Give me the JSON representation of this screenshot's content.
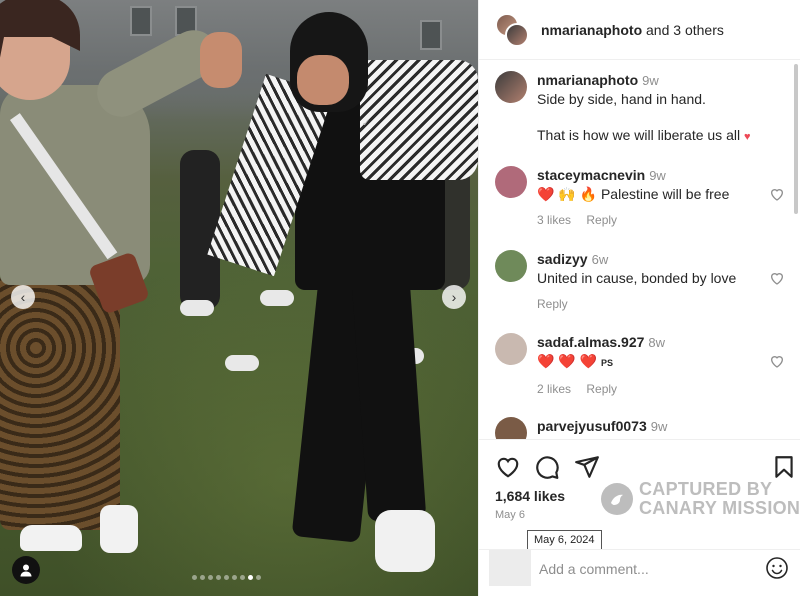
{
  "header": {
    "username": "nmarianaphoto",
    "others": "and 3 others"
  },
  "caption": {
    "username": "nmarianaphoto",
    "time": "9w",
    "line1": "Side by side, hand in hand.",
    "line2": "That is how we will liberate us all",
    "line2_emoji": "♥"
  },
  "comments": [
    {
      "username": "staceymacnevin",
      "time": "9w",
      "emoji": "❤️ 🙌 🔥",
      "text": "Palestine will be free",
      "likes": "3 likes",
      "reply": "Reply",
      "avatar_color": "#b06a7a"
    },
    {
      "username": "sadizyy",
      "time": "6w",
      "emoji": "",
      "text": "United in cause, bonded by love",
      "likes": "",
      "reply": "Reply",
      "avatar_color": "#6f8a5a"
    },
    {
      "username": "sadaf.almas.927",
      "time": "8w",
      "emoji": "❤️ ❤️ ❤️",
      "text": "PS",
      "likes": "2 likes",
      "reply": "Reply",
      "avatar_color": "#c9b9b0"
    },
    {
      "username": "parvejyusuf0073",
      "time": "9w",
      "emoji": "",
      "text": "",
      "likes": "",
      "reply": "",
      "avatar_color": "#7a5b46"
    }
  ],
  "actions": {
    "likes": "1,684 likes",
    "date": "May 6",
    "tooltip": "May 6, 2024"
  },
  "watermark": {
    "line1": "CAPTURED BY",
    "line2": "CANARY MISSION"
  },
  "add_comment": {
    "placeholder": "Add a comment..."
  },
  "carousel": {
    "dot_count": 9,
    "active_index": 7
  },
  "icons": {
    "prev": "chevron-left-icon",
    "next": "chevron-right-icon",
    "like": "heart-icon",
    "comment": "comment-icon",
    "share": "send-icon",
    "save": "bookmark-icon",
    "emoji": "smiley-icon",
    "tag": "person-icon"
  },
  "colors": {
    "text": "#262626",
    "muted": "#8e8e8e",
    "heart": "#ed4956",
    "border": "#efefef",
    "watermark": "#bdbdbd"
  }
}
